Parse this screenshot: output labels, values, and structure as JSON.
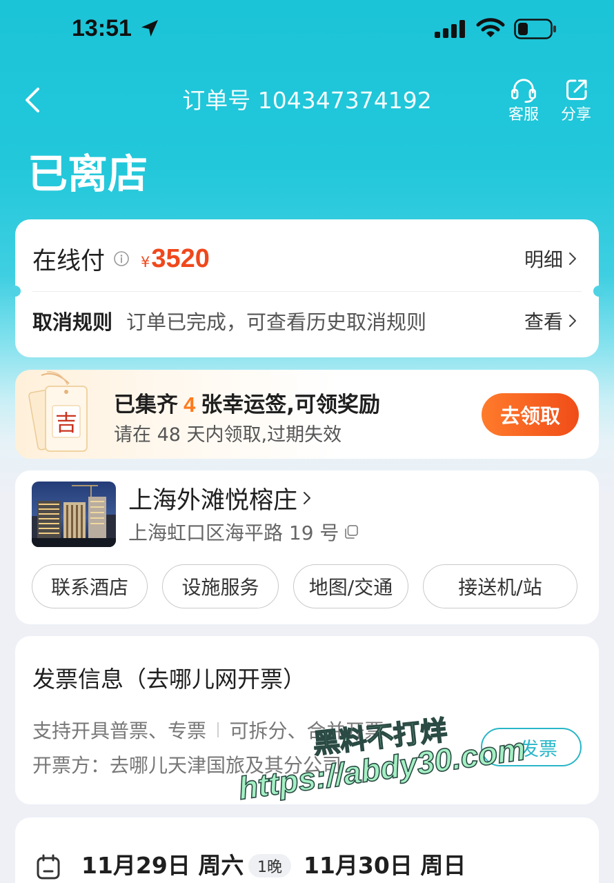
{
  "status_bar": {
    "time": "13:51"
  },
  "header": {
    "title": "订单号 104347374192",
    "service_label": "客服",
    "share_label": "分享"
  },
  "order_status": "已离店",
  "payment": {
    "method": "在线付",
    "currency": "¥",
    "amount": "3520",
    "detail_label": "明细",
    "cancel_title": "取消规则",
    "cancel_text": "订单已完成，可查看历史取消规则",
    "view_label": "查看"
  },
  "lucky": {
    "tag_char": "吉",
    "title_prefix": "已集齐",
    "count": "4",
    "title_suffix": "张幸运签,可领奖励",
    "subtitle": "请在 48 天内领取,过期失效",
    "button": "去领取"
  },
  "hotel": {
    "name": "上海外滩悦榕庄",
    "address": "上海虹口区海平路 19 号",
    "actions": [
      "联系酒店",
      "设施服务",
      "地图/交通",
      "接送机/站"
    ]
  },
  "invoice": {
    "title": "发票信息（去哪儿网开票）",
    "support_types": "支持开具普票、专票",
    "support_split": "可拆分、合并开票",
    "issuer": "开票方：去哪儿天津国旅及其分公司",
    "button": "发票"
  },
  "stay": {
    "checkin": "11月29日 周六",
    "nights": "1晚",
    "checkout": "11月30日 周日"
  },
  "watermark": {
    "line1": "黑料不打烊",
    "line2": "https://abdy30.com"
  },
  "icons": {
    "back": "back-icon",
    "service": "headset-icon",
    "share": "share-icon",
    "info": "info-icon",
    "chevron": "chevron-right-icon",
    "copy": "copy-icon",
    "calendar": "calendar-icon",
    "status": [
      "location-arrow-icon",
      "cellular-signal-icon",
      "wifi-icon",
      "battery-icon"
    ]
  },
  "colors": {
    "header_bg": "#1cc4d8",
    "page_bg": "#eef0f6",
    "price": "#f0481c",
    "lucky_count": "#ff7a1c",
    "cta_start": "#ff7b2c",
    "cta_end": "#f04d18",
    "invoice_accent": "#27b6c7"
  }
}
